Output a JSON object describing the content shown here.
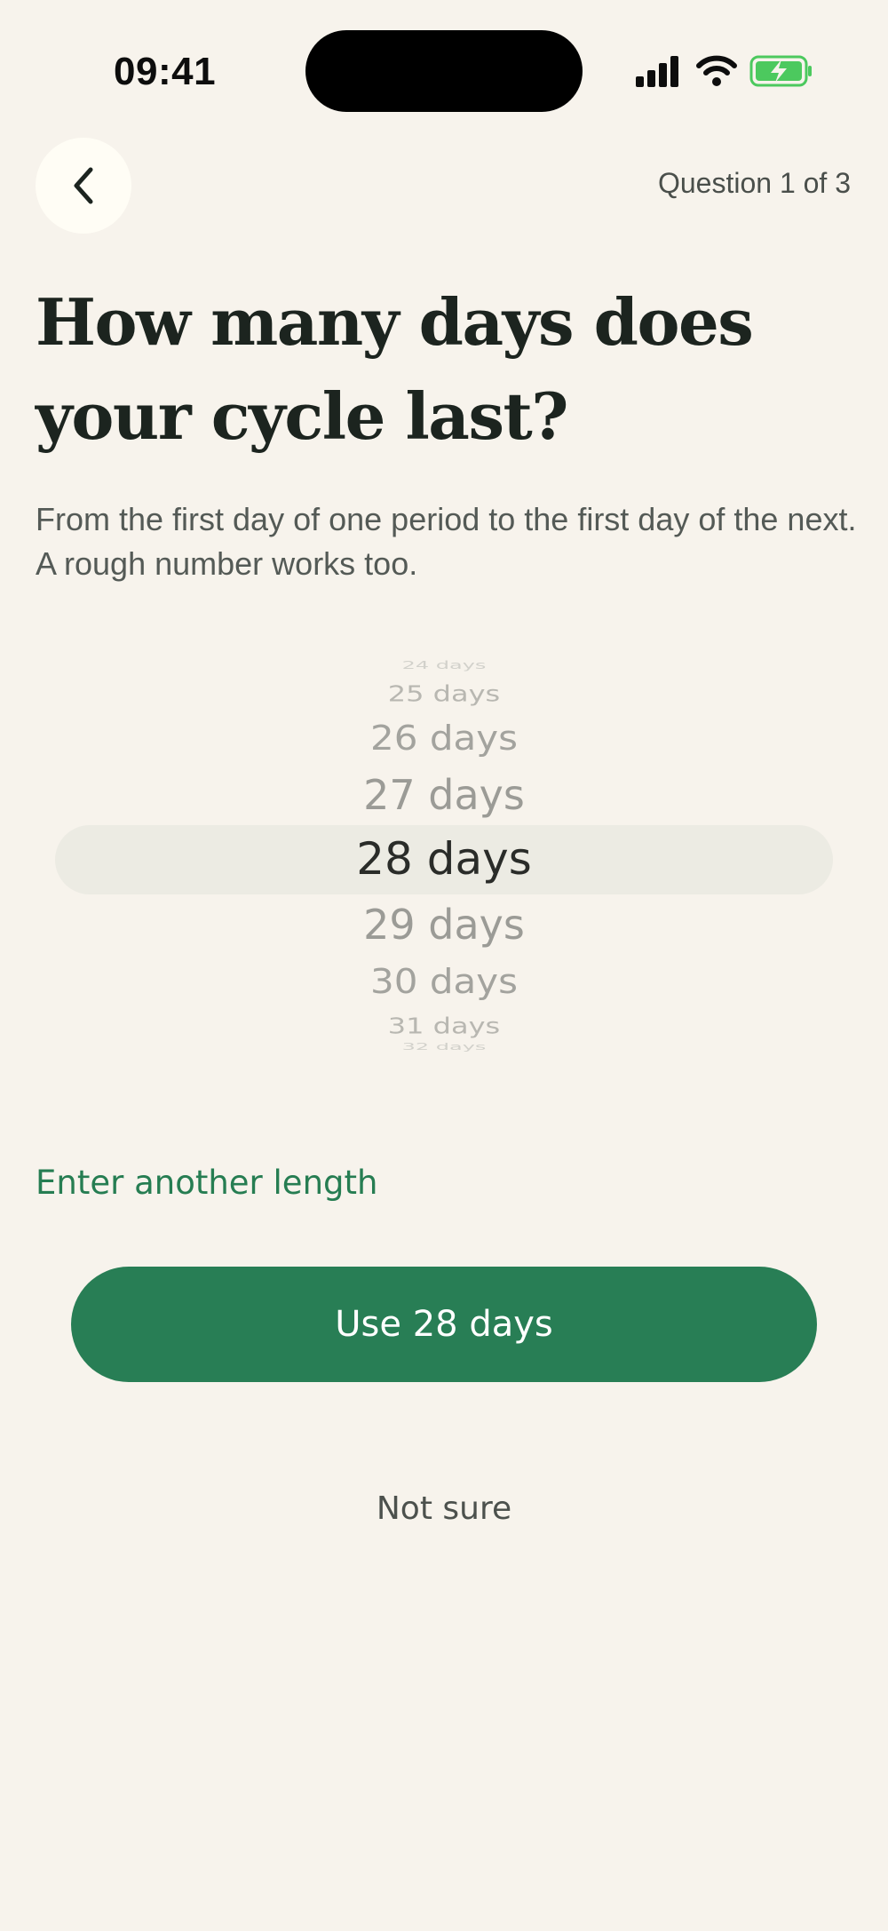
{
  "status_bar": {
    "time": "09:41",
    "icons": [
      "signal-icon",
      "wifi-icon",
      "battery-charging-icon"
    ],
    "battery_color": "#4cc95e"
  },
  "header": {
    "back_icon": "chevron-left-icon",
    "progress": "Question 1 of 3"
  },
  "question": {
    "title": "How many days does your cycle last?",
    "subtitle": "From the first day of one period to the first day of the next. A rough number works too."
  },
  "picker": {
    "items": [
      "24 days",
      "25 days",
      "26 days",
      "27 days",
      "28 days",
      "29 days",
      "30 days",
      "31 days",
      "32 days"
    ],
    "selected": "28 days"
  },
  "actions": {
    "alt_link": "Enter another length",
    "primary": "Use 28 days",
    "secondary": "Not sure"
  },
  "colors": {
    "accent": "#287e55",
    "background": "#f7f3ec"
  }
}
